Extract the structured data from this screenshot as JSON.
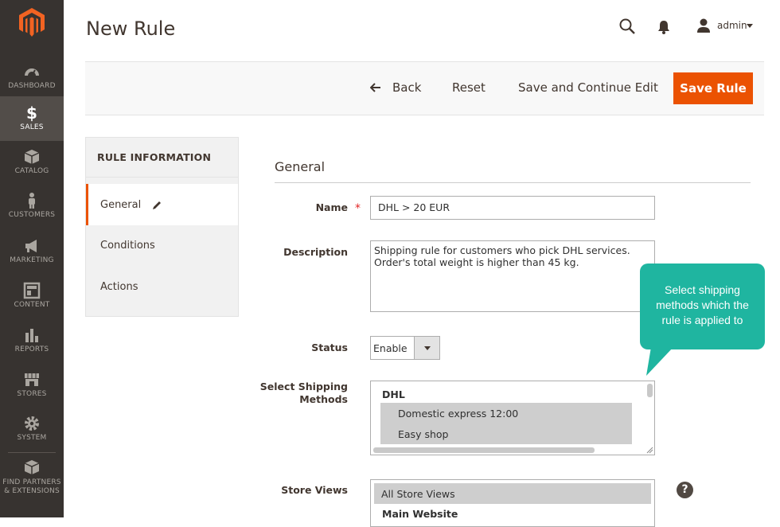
{
  "sidebar": {
    "items": [
      {
        "label": "DASHBOARD",
        "icon": "dashboard-icon"
      },
      {
        "label": "SALES",
        "icon": "dollar-icon"
      },
      {
        "label": "CATALOG",
        "icon": "box-icon"
      },
      {
        "label": "CUSTOMERS",
        "icon": "person-icon"
      },
      {
        "label": "MARKETING",
        "icon": "megaphone-icon"
      },
      {
        "label": "CONTENT",
        "icon": "layout-icon"
      },
      {
        "label": "REPORTS",
        "icon": "bar-chart-icon"
      },
      {
        "label": "STORES",
        "icon": "storefront-icon"
      },
      {
        "label": "SYSTEM",
        "icon": "gear-icon"
      },
      {
        "label_1": "FIND PARTNERS",
        "label_2": "& EXTENSIONS",
        "icon": "cube-icon"
      }
    ],
    "active": "SALES"
  },
  "header": {
    "title": "New Rule",
    "username": "admin"
  },
  "actions": {
    "back": "Back",
    "reset": "Reset",
    "save_continue": "Save and Continue Edit",
    "save": "Save Rule"
  },
  "tabs": {
    "title": "RULE INFORMATION",
    "items": [
      "General",
      "Conditions",
      "Actions"
    ],
    "active": "General"
  },
  "form": {
    "section_title": "General",
    "name_label": "Name",
    "name_value": "DHL > 20 EUR",
    "description_label": "Description",
    "description_value": "Shipping rule for customers who pick DHL services. Order's total weight is higher than 45 kg.",
    "status_label": "Status",
    "status_value": "Enable",
    "shipping_label_1": "Select Shipping",
    "shipping_label_2": "Methods",
    "shipping_group": "DHL",
    "shipping_options": [
      "Domestic express 12:00",
      "Easy shop"
    ],
    "store_views_label": "Store Views",
    "store_views_options": [
      "All Store Views"
    ],
    "store_views_group": "Main Website"
  },
  "tooltip": {
    "line_1": "Select shipping",
    "line_2": "methods which the",
    "line_3": "rule is applied to"
  },
  "colors": {
    "accent": "#eb5202",
    "sidebar": "#373330",
    "tooltip": "#1fb5a0"
  }
}
